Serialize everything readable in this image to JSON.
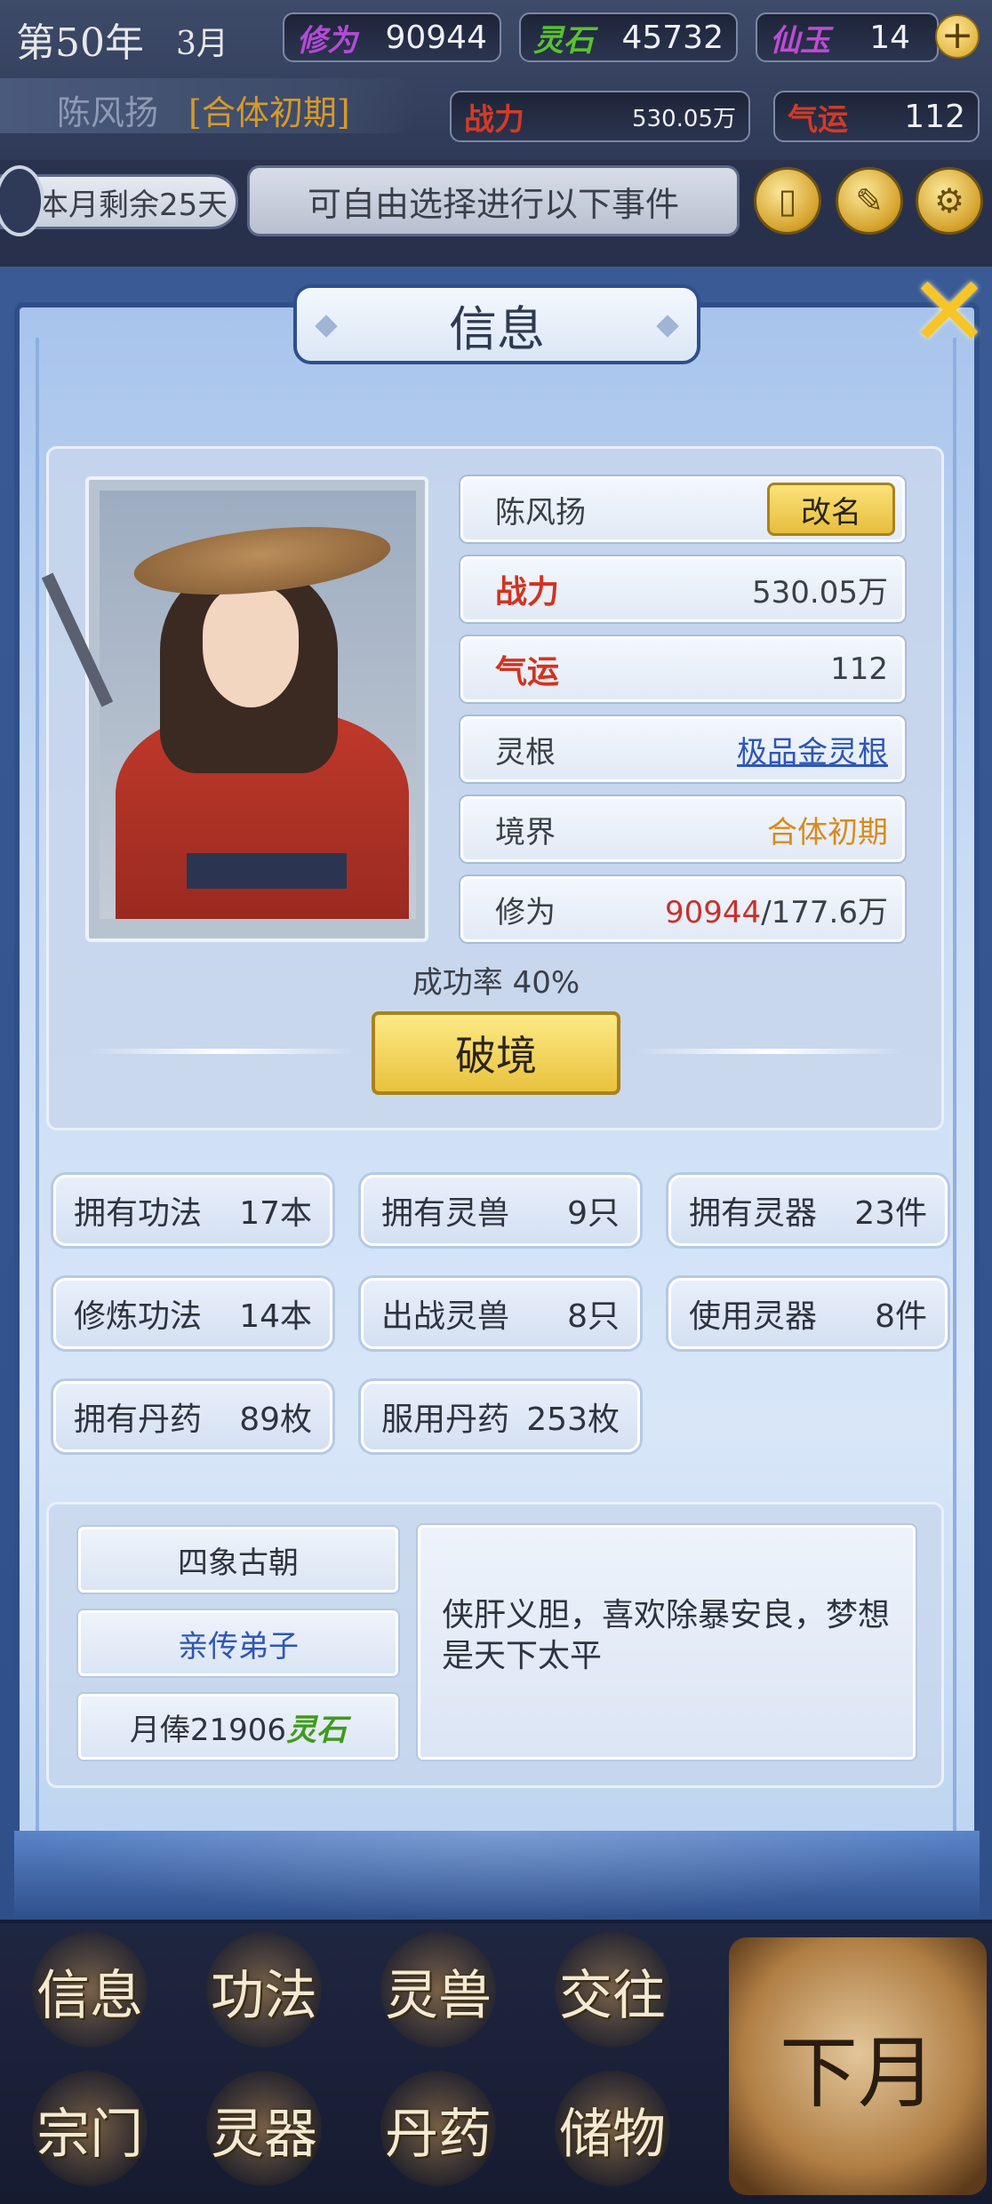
{
  "hud": {
    "year": "第50年",
    "month": "3月",
    "cultivation": {
      "label": "修为",
      "value": "90944",
      "color": "#b34ad6"
    },
    "spirit_stone": {
      "label": "灵石",
      "value": "45732",
      "color": "#59c22e"
    },
    "immortal_jade": {
      "label": "仙玉",
      "value": "14",
      "color": "#c04ad6"
    },
    "character_name": "陈风扬",
    "realm_tag": "[合体初期]",
    "combat_power": {
      "label": "战力",
      "value": "530.05万"
    },
    "luck": {
      "label": "气运",
      "value": "112"
    },
    "days_left": "本月剩余25天",
    "event_hint": "可自由选择进行以下事件",
    "icons": [
      "cards-icon",
      "brush-icon",
      "gear-icon",
      "plus-icon"
    ]
  },
  "panel": {
    "title": "信息",
    "rename_label": "改名",
    "name": "陈风扬",
    "stats": [
      {
        "label": "战力",
        "value": "530.05万"
      },
      {
        "label": "气运",
        "value": "112"
      },
      {
        "label": "灵根",
        "value": "极品金灵根"
      },
      {
        "label": "境界",
        "value": "合体初期"
      }
    ],
    "cultivation": {
      "label": "修为",
      "current": "90944",
      "max": "/177.6万"
    },
    "success_rate": "成功率 40%",
    "breakthrough_label": "破境"
  },
  "counts": [
    {
      "label": "拥有功法",
      "value": "17本"
    },
    {
      "label": "拥有灵兽",
      "value": "9只"
    },
    {
      "label": "拥有灵器",
      "value": "23件"
    },
    {
      "label": "修炼功法",
      "value": "14本"
    },
    {
      "label": "出战灵兽",
      "value": "8只"
    },
    {
      "label": "使用灵器",
      "value": "8件"
    },
    {
      "label": "拥有丹药",
      "value": "89枚"
    },
    {
      "label": "服用丹药",
      "value": "253枚"
    }
  ],
  "faction": {
    "name": "四象古朝",
    "role": "亲传弟子",
    "salary_prefix": "月俸21906",
    "salary_unit": "灵石",
    "motto": "侠肝义胆，喜欢除暴安良，梦想是天下太平"
  },
  "nav": {
    "items": [
      "信息",
      "功法",
      "灵兽",
      "交往",
      "宗门",
      "灵器",
      "丹药",
      "储物"
    ],
    "next_month": "下月"
  }
}
